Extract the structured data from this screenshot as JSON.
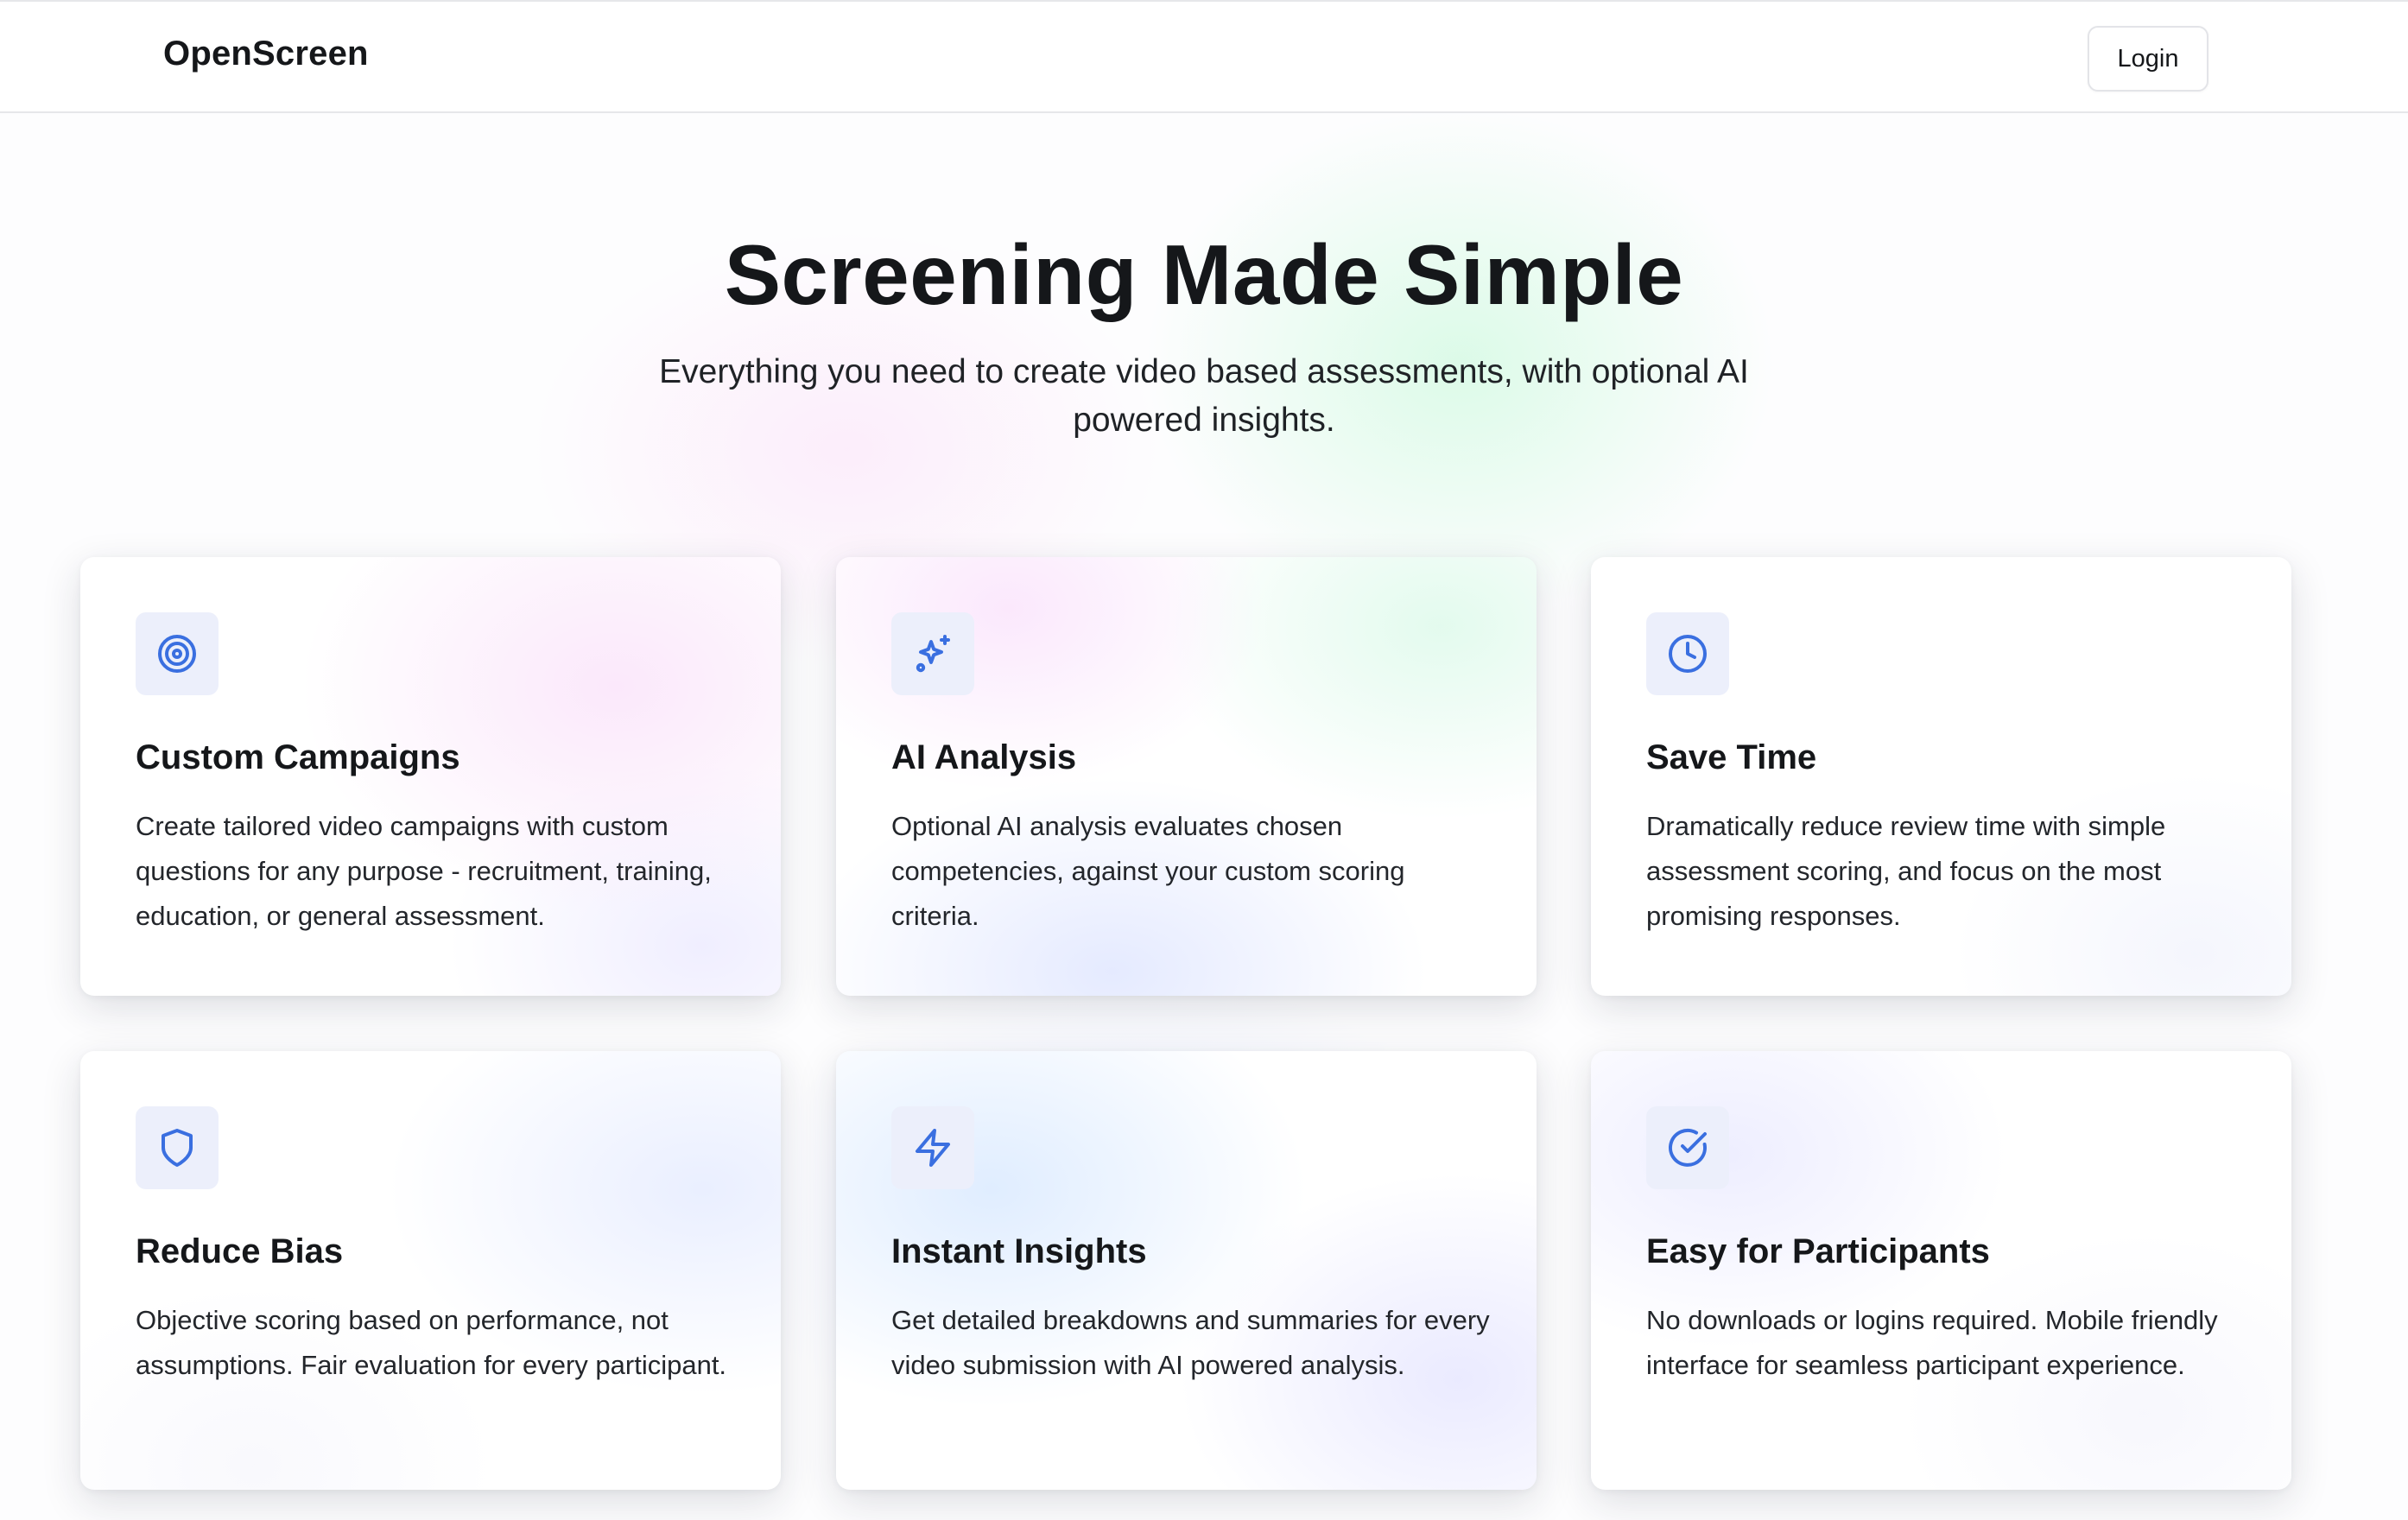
{
  "header": {
    "brand": "OpenScreen",
    "login_label": "Login"
  },
  "hero": {
    "title": "Screening Made Simple",
    "subtitle": "Everything you need to create video based assessments, with optional AI powered insights."
  },
  "colors": {
    "icon_accent": "#3a6fe0",
    "icon_bg": "#eceffb",
    "text_primary": "#15171a"
  },
  "features": [
    {
      "icon": "target-icon",
      "title": "Custom Campaigns",
      "description": "Create tailored video campaigns with custom questions for any purpose - recruitment, training, education, or general assessment."
    },
    {
      "icon": "sparkles-icon",
      "title": "AI Analysis",
      "description": "Optional AI analysis evaluates chosen competencies, against your custom scoring criteria."
    },
    {
      "icon": "clock-icon",
      "title": "Save Time",
      "description": "Dramatically reduce review time with simple assessment scoring, and focus on the most promising responses."
    },
    {
      "icon": "shield-icon",
      "title": "Reduce Bias",
      "description": "Objective scoring based on performance, not assumptions. Fair evaluation for every participant."
    },
    {
      "icon": "lightning-icon",
      "title": "Instant Insights",
      "description": "Get detailed breakdowns and summaries for every video submission with AI powered analysis."
    },
    {
      "icon": "check-circle-icon",
      "title": "Easy for Participants",
      "description": "No downloads or logins required. Mobile friendly interface for seamless participant experience."
    }
  ]
}
